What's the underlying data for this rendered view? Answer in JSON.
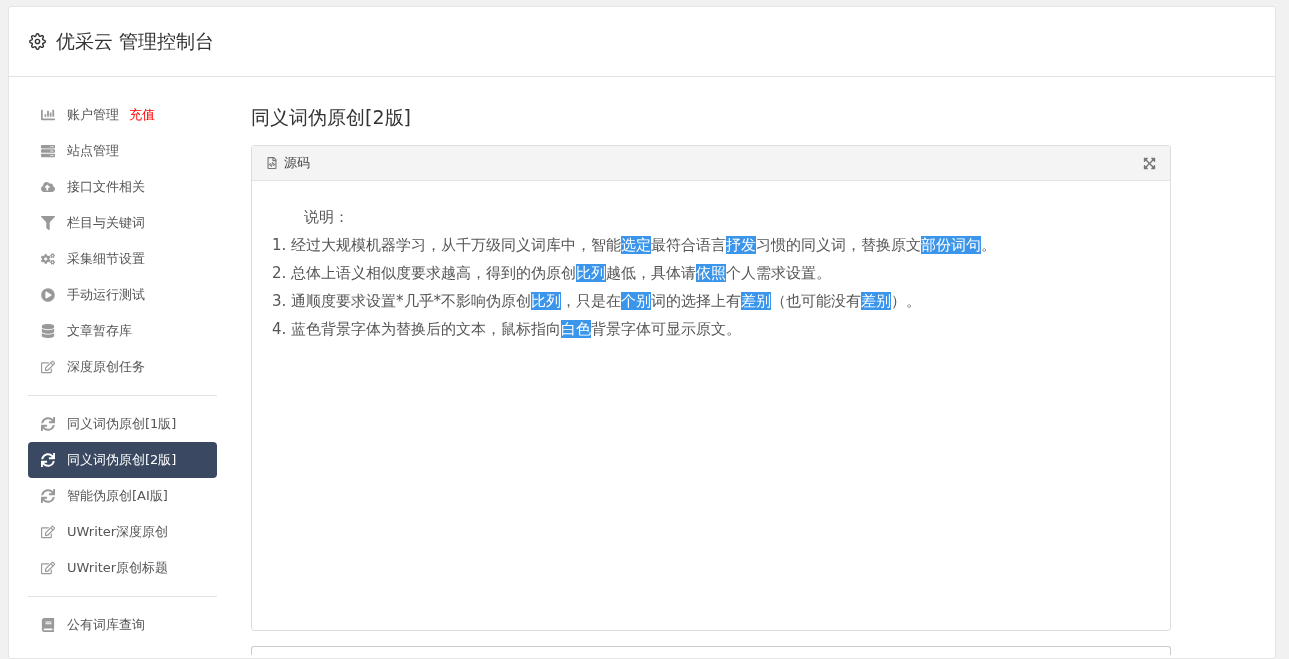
{
  "header": {
    "title": "优采云 管理控制台"
  },
  "sidebar": {
    "groups": [
      {
        "items": [
          {
            "label": "账户管理",
            "badge": "充值",
            "selected": false
          },
          {
            "label": "站点管理",
            "selected": false
          },
          {
            "label": "接口文件相关",
            "selected": false
          },
          {
            "label": "栏目与关键词",
            "selected": false
          },
          {
            "label": "采集细节设置",
            "selected": false
          },
          {
            "label": "手动运行测试",
            "selected": false
          },
          {
            "label": "文章暂存库",
            "selected": false
          },
          {
            "label": "深度原创任务",
            "selected": false
          }
        ]
      },
      {
        "items": [
          {
            "label": "同义词伪原创[1版]",
            "selected": false
          },
          {
            "label": "同义词伪原创[2版]",
            "selected": true
          },
          {
            "label": "智能伪原创[AI版]",
            "selected": false
          },
          {
            "label": "UWriter深度原创",
            "selected": false
          },
          {
            "label": "UWriter原创标题",
            "selected": false
          }
        ]
      },
      {
        "items": [
          {
            "label": "公有词库查询",
            "selected": false
          }
        ]
      }
    ]
  },
  "main": {
    "title": "同义词伪原创[2版]",
    "panel": {
      "tab": "源码",
      "intro": "说明：",
      "lines": [
        [
          {
            "text": "1. 经过大规模机器学习，从千万级同义词库中，智能",
            "highlighted": false
          },
          {
            "text": "选定",
            "highlighted": true
          },
          {
            "text": "最符合语言",
            "highlighted": false
          },
          {
            "text": "抒发",
            "highlighted": true
          },
          {
            "text": "习惯的同义词，替换原文",
            "highlighted": false
          },
          {
            "text": "部份",
            "highlighted": true
          },
          {
            "text": "词句",
            "highlighted": true
          },
          {
            "text": "。",
            "highlighted": false
          }
        ],
        [
          {
            "text": "2. 总体上语义相似度要求越高，得到的伪原创",
            "highlighted": false
          },
          {
            "text": "比列",
            "highlighted": true
          },
          {
            "text": "越低，具体请",
            "highlighted": false
          },
          {
            "text": "依照",
            "highlighted": true
          },
          {
            "text": "个人需求设置。",
            "highlighted": false
          }
        ],
        [
          {
            "text": "3. 通顺度要求设置*几乎*不影响伪原创",
            "highlighted": false
          },
          {
            "text": "比列",
            "highlighted": true
          },
          {
            "text": "，只是在",
            "highlighted": false
          },
          {
            "text": "个别",
            "highlighted": true
          },
          {
            "text": "词的选择上有",
            "highlighted": false
          },
          {
            "text": "差别",
            "highlighted": true
          },
          {
            "text": "（也可能没有",
            "highlighted": false
          },
          {
            "text": "差别",
            "highlighted": true
          },
          {
            "text": "）。",
            "highlighted": false
          }
        ],
        [
          {
            "text": "4. 蓝色背景字体为替换后的文本，鼠标指向",
            "highlighted": false
          },
          {
            "text": "白色",
            "highlighted": true
          },
          {
            "text": "背景字体可显示原文。",
            "highlighted": false
          }
        ]
      ]
    }
  }
}
